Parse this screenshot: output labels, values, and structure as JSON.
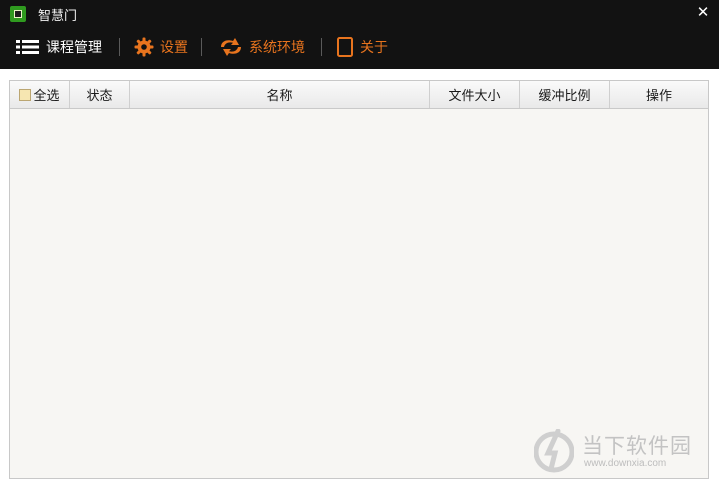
{
  "window": {
    "title": "智慧门",
    "close_glyph": "✕"
  },
  "toolbar": {
    "course_manage_label": "课程管理",
    "settings_label": "设置",
    "environment_label": "系统环境",
    "about_label": "关于"
  },
  "grid": {
    "columns": {
      "select_all": "全选",
      "status": "状态",
      "name": "名称",
      "file_size": "文件大小",
      "buffer_ratio": "缓冲比例",
      "actions": "操作"
    },
    "rows": []
  },
  "watermark": {
    "text": "当下软件园",
    "url": "www.downxia.com"
  },
  "colors": {
    "accent": "#e8741e",
    "titlebar": "#121212",
    "content_bg": "#f7f6f3"
  }
}
